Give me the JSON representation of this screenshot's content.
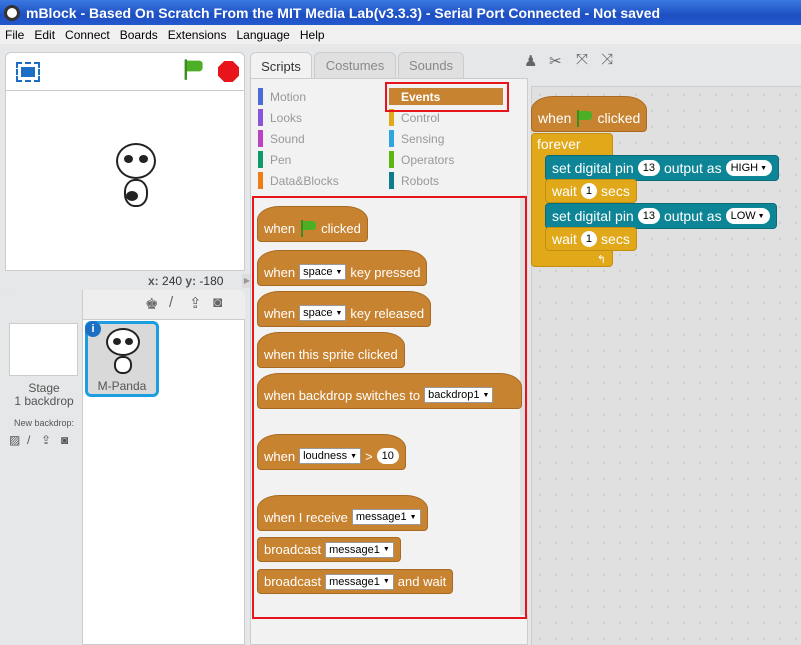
{
  "window": {
    "title": "mBlock - Based On Scratch From the MIT Media Lab(v3.3.3) - Serial Port Connected - Not saved"
  },
  "menu": [
    "File",
    "Edit",
    "Connect",
    "Boards",
    "Extensions",
    "Language",
    "Help"
  ],
  "stage": {
    "x_label": "x:",
    "x_value": "240",
    "y_label": "y:",
    "y_value": "-180"
  },
  "sprites": {
    "stage_label": "Stage",
    "backdrop_count": "1 backdrop",
    "new_backdrop": "New backdrop:",
    "sprite_name": "M-Panda"
  },
  "tabs": [
    "Scripts",
    "Costumes",
    "Sounds"
  ],
  "categories": [
    {
      "label": "Motion",
      "color": "#4a6cd4"
    },
    {
      "label": "Events",
      "color": "#c88330"
    },
    {
      "label": "Looks",
      "color": "#8a55d7"
    },
    {
      "label": "Control",
      "color": "#e1a91a"
    },
    {
      "label": "Sound",
      "color": "#bb42c3"
    },
    {
      "label": "Sensing",
      "color": "#2ca5e2"
    },
    {
      "label": "Pen",
      "color": "#0e9a6c"
    },
    {
      "label": "Operators",
      "color": "#5cb712"
    },
    {
      "label": "Data&Blocks",
      "color": "#ee7d16"
    },
    {
      "label": "Robots",
      "color": "#0e7c8c"
    }
  ],
  "palette": {
    "when": "when",
    "clicked": "clicked",
    "key_pressed": "key pressed",
    "key_released": "key released",
    "space": "space",
    "sprite_clicked": "when this sprite clicked",
    "backdrop_switches": "when backdrop switches to",
    "backdrop1": "backdrop1",
    "loudness": "loudness",
    "gt": ">",
    "ten": "10",
    "when_receive": "when I receive",
    "message1": "message1",
    "broadcast": "broadcast",
    "and_wait": "and wait"
  },
  "script": {
    "when": "when",
    "clicked": "clicked",
    "forever": "forever",
    "set_pin": "set digital pin",
    "pin": "13",
    "output_as": "output as",
    "high": "HIGH",
    "low": "LOW",
    "wait": "wait",
    "secs": "secs",
    "one": "1"
  }
}
